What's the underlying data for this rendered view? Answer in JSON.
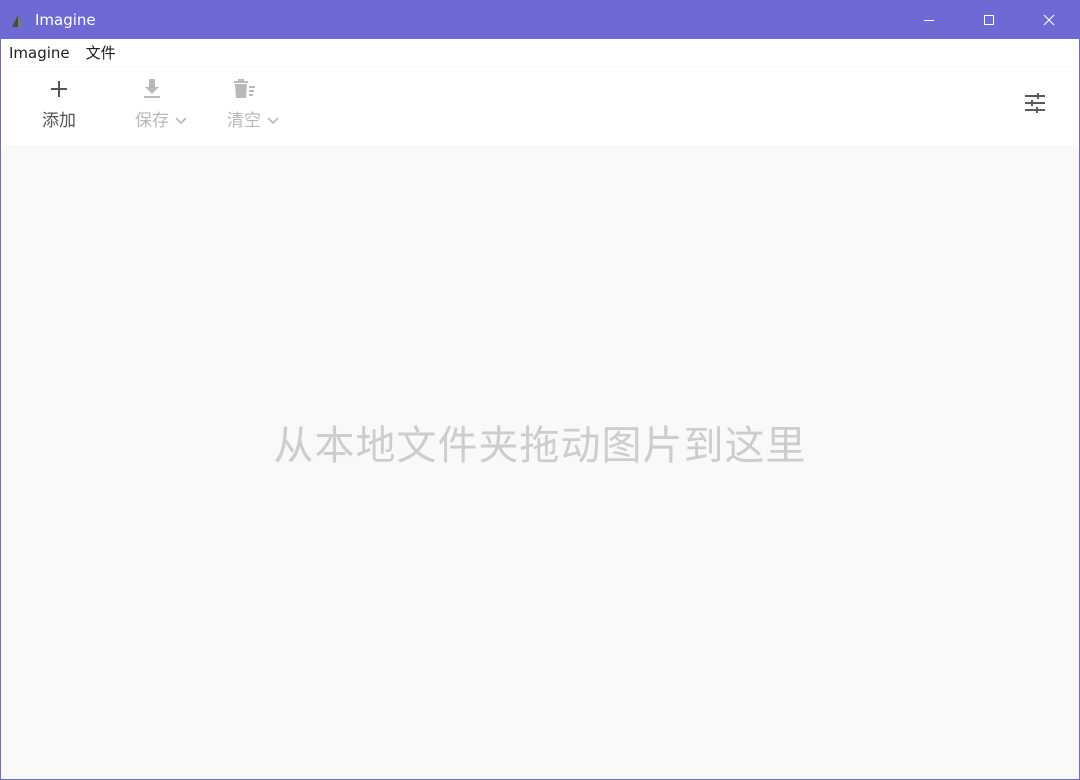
{
  "window": {
    "title": "Imagine",
    "accent_color": "#6d6ad6",
    "controls": [
      "minimize-icon",
      "maximize-icon",
      "close-icon"
    ]
  },
  "menubar": {
    "items": [
      {
        "label": "Imagine"
      },
      {
        "label": "文件"
      }
    ]
  },
  "toolbar": {
    "add": {
      "label": "添加",
      "icon": "plus-icon",
      "enabled": true
    },
    "save": {
      "label": "保存",
      "icon": "download-icon",
      "enabled": false,
      "has_dropdown": true
    },
    "clear": {
      "label": "清空",
      "icon": "trash-list-icon",
      "enabled": false,
      "has_dropdown": true
    },
    "settings": {
      "icon": "sliders-icon"
    }
  },
  "main": {
    "drop_hint": "从本地文件夹拖动图片到这里"
  }
}
